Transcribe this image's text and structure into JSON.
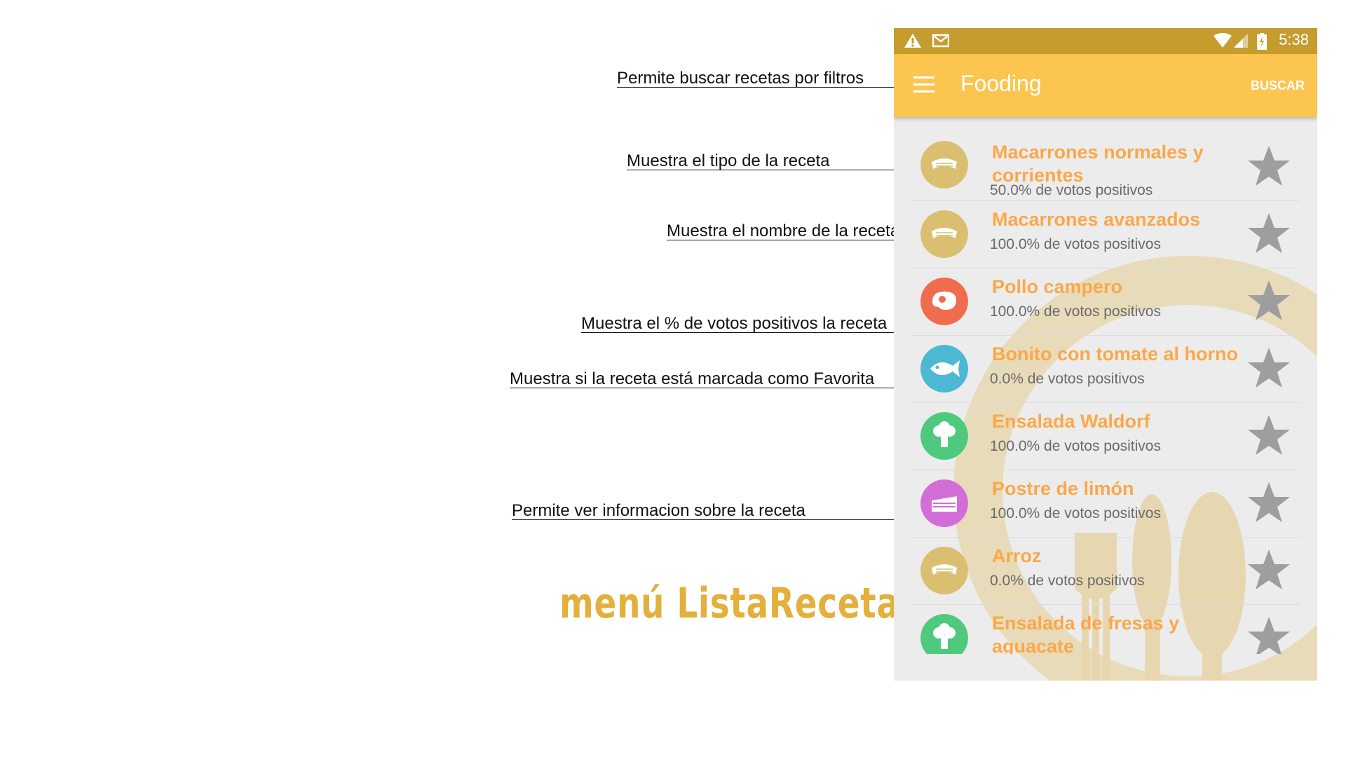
{
  "annotations": {
    "search": "Permite buscar recetas por filtros",
    "type": "Muestra el tipo de la receta",
    "name": "Muestra el nombre de la receta",
    "votes": "Muestra el % de votos positivos la receta",
    "favorite": "Muestra si la receta está marcada como Favorita",
    "info": "Permite ver informacion sobre la receta"
  },
  "caption": "menú ListaRecetas",
  "status_bar": {
    "time": "5:38",
    "icons": [
      "warning-icon",
      "gmail-icon",
      "wifi-icon",
      "signal-icon",
      "battery-icon"
    ]
  },
  "app_bar": {
    "title": "Fooding",
    "search_label": "BUSCAR",
    "menu_icon": "hamburger-menu-icon"
  },
  "recipes": [
    {
      "name": "Macarrones normales y corrientes",
      "votes": "50.0% de votos positivos",
      "type": "pasta",
      "color": "#d9bf6f"
    },
    {
      "name": "Macarrones avanzados",
      "votes": "100.0% de votos positivos",
      "type": "pasta",
      "color": "#d9bf6f"
    },
    {
      "name": "Pollo campero",
      "votes": "100.0% de votos positivos",
      "type": "meat",
      "color": "#ef6d4e"
    },
    {
      "name": "Bonito con tomate al horno",
      "votes": "0.0% de votos positivos",
      "type": "fish",
      "color": "#4db8d3"
    },
    {
      "name": "Ensalada Waldorf",
      "votes": "100.0% de votos positivos",
      "type": "vegetable",
      "color": "#4ec97d"
    },
    {
      "name": "Postre de limón",
      "votes": "100.0% de votos positivos",
      "type": "dessert",
      "color": "#d36ed8"
    },
    {
      "name": "Arroz",
      "votes": "0.0% de votos positivos",
      "type": "pasta",
      "color": "#d9bf6f"
    },
    {
      "name": "Ensalada de fresas y aguacate",
      "votes": "",
      "type": "vegetable",
      "color": "#4ec97d"
    }
  ],
  "colors": {
    "status_bar": "#c79c2e",
    "app_bar": "#fcc550",
    "recipe_title": "#fba84a",
    "caption": "#e3b03c",
    "star": "#9e9e9e"
  }
}
